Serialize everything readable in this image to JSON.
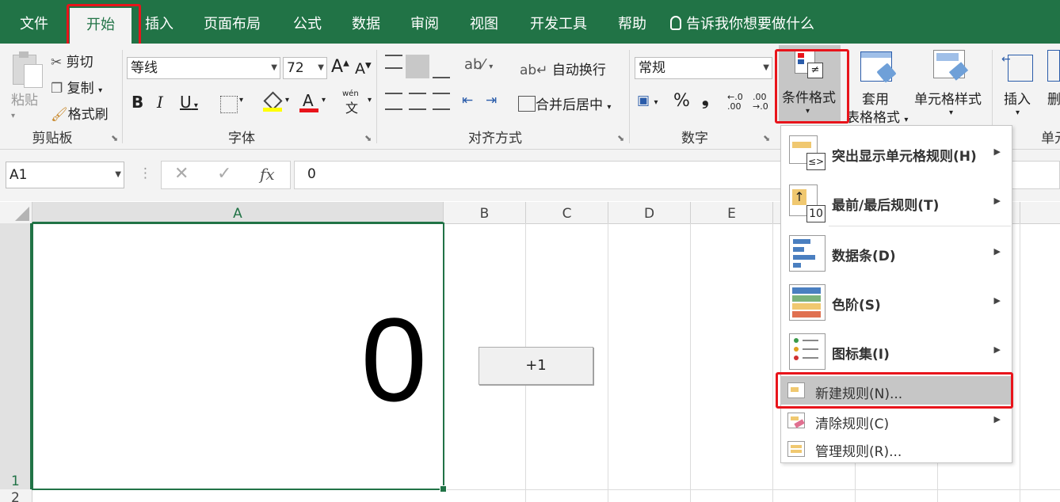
{
  "tabs": [
    "文件",
    "开始",
    "插入",
    "页面布局",
    "公式",
    "数据",
    "审阅",
    "视图",
    "开发工具",
    "帮助"
  ],
  "tell_me": "告诉我你想要做什么",
  "clipboard": {
    "paste": "粘贴",
    "cut": "剪切",
    "copy": "复制",
    "format_painter": "格式刷",
    "group": "剪贴板"
  },
  "font": {
    "name": "等线",
    "size": "72",
    "bold": "B",
    "italic": "I",
    "underline": "U",
    "grow": "A",
    "shrink": "A",
    "phonetic": "wén",
    "phonetic_char": "文",
    "color_letter": "A",
    "group": "字体"
  },
  "alignment": {
    "wrap": "自动换行",
    "merge": "合并后居中",
    "group": "对齐方式"
  },
  "number": {
    "format": "常规",
    "percent": "%",
    "comma": "❟",
    "inc_decimal": ".00",
    "dec_decimal": ".00",
    "group": "数字"
  },
  "styles": {
    "conditional": "条件格式",
    "table_format_1": "套用",
    "table_format_2": "表格格式",
    "cell_styles": "单元格样式"
  },
  "cells": {
    "insert": "插入",
    "delete": "删",
    "group": "单元"
  },
  "formula_bar": {
    "name_box": "A1",
    "fx": "fx",
    "value": "0"
  },
  "columns": [
    "A",
    "B",
    "C",
    "D",
    "E"
  ],
  "rows": [
    "1",
    "2"
  ],
  "cell_a1": "0",
  "sheet_button": "+1",
  "menu": {
    "highlight": "突出显示单元格规则(H)",
    "highlight_num": "≤>",
    "topbottom": "最前/最后规则(T)",
    "topbottom_num": "10",
    "databar": "数据条(D)",
    "colorscale": "色阶(S)",
    "iconset": "图标集(I)",
    "newrule": "新建规则(N)...",
    "clearrule": "清除规则(C)",
    "managerule": "管理规则(R)..."
  },
  "colors": {
    "excel_green": "#217346",
    "highlight_red": "#e8141b",
    "menu_hover": "#c6c6c6"
  }
}
